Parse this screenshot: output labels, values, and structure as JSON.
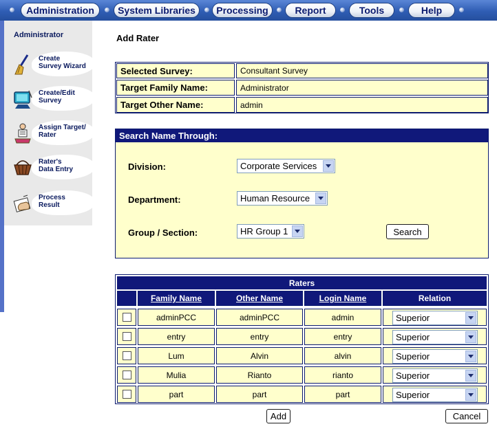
{
  "nav": {
    "items": [
      "Administration",
      "System Libraries",
      "Processing",
      "Report",
      "Tools",
      "Help"
    ]
  },
  "sidebar": {
    "title": "Administrator",
    "items": [
      {
        "line1": "Create",
        "line2": "Survey Wizard",
        "icon": "broom-icon"
      },
      {
        "line1": "Create/Edit",
        "line2": "Survey",
        "icon": "monitor-icon"
      },
      {
        "line1": "Assign Target/",
        "line2": "Rater",
        "icon": "person-icon"
      },
      {
        "line1": "Rater's",
        "line2": "Data Entry",
        "icon": "basket-icon"
      },
      {
        "line1": "Process",
        "line2": "Result",
        "icon": "hand-icon"
      }
    ]
  },
  "page": {
    "title": "Add Rater"
  },
  "info": {
    "selected_survey_label": "Selected Survey:",
    "selected_survey_value": "Consultant Survey",
    "target_family_label": "Target Family Name:",
    "target_family_value": "Administrator",
    "target_other_label": "Target Other Name:",
    "target_other_value": "admin"
  },
  "search": {
    "header": "Search Name Through:",
    "division_label": "Division:",
    "division_value": "Corporate Services",
    "department_label": "Department:",
    "department_value": "Human Resource",
    "group_label": "Group / Section:",
    "group_value": "HR Group 1",
    "search_button": "Search"
  },
  "raters": {
    "title": "Raters",
    "columns": [
      "Family Name",
      "Other Name",
      "Login Name",
      "Relation"
    ],
    "rows": [
      {
        "family": "adminPCC",
        "other": "adminPCC",
        "login": "admin",
        "relation": "Superior"
      },
      {
        "family": "entry",
        "other": "entry",
        "login": "entry",
        "relation": "Superior"
      },
      {
        "family": "Lum",
        "other": "Alvin",
        "login": "alvin",
        "relation": "Superior"
      },
      {
        "family": "Mulia",
        "other": "Rianto",
        "login": "rianto",
        "relation": "Superior"
      },
      {
        "family": "part",
        "other": "part",
        "login": "part",
        "relation": "Superior"
      }
    ]
  },
  "actions": {
    "add": "Add",
    "cancel": "Cancel"
  }
}
